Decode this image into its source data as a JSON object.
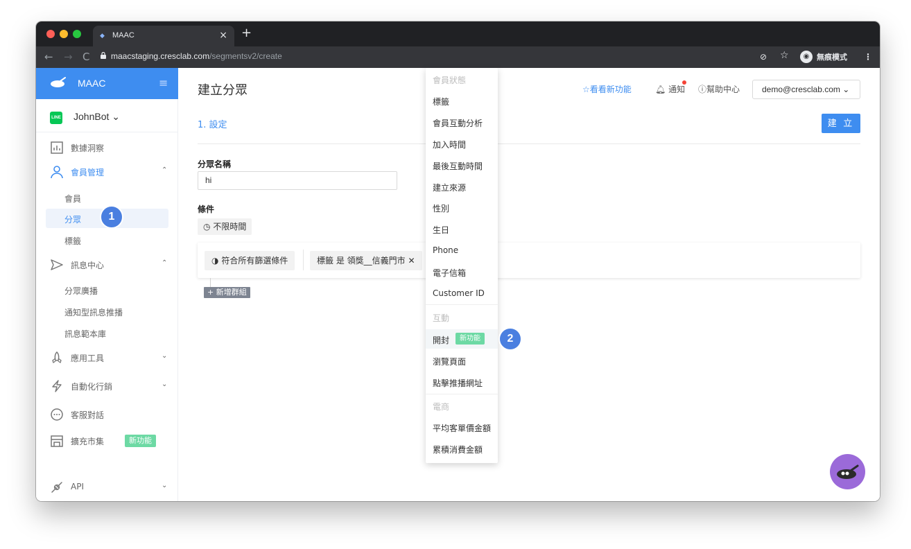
{
  "browser": {
    "tab_title": "MAAC",
    "url_host": "maacstaging.cresclab.com",
    "url_path": "/segmentsv2/create",
    "incognito_label": "無痕模式"
  },
  "sidebar": {
    "brand": "MAAC",
    "bot_name": "JohnBot",
    "line_badge": "LINE",
    "items": [
      {
        "label": "數據洞察"
      },
      {
        "label": "會員管理"
      },
      {
        "label": "會員"
      },
      {
        "label": "分眾"
      },
      {
        "label": "標籤"
      },
      {
        "label": "訊息中心"
      },
      {
        "label": "分眾廣播"
      },
      {
        "label": "通知型訊息推播"
      },
      {
        "label": "訊息範本庫"
      },
      {
        "label": "應用工具"
      },
      {
        "label": "自動化行銷"
      },
      {
        "label": "客服對話"
      },
      {
        "label": "擴充市集"
      },
      {
        "label": "API"
      }
    ],
    "new_tag": "新功能"
  },
  "header": {
    "title": "建立分眾",
    "whats_new": "看看新功能",
    "notify": "通知",
    "help": "幫助中心",
    "user": "demo@cresclab.com"
  },
  "form": {
    "step": "1. 設定",
    "create_button": "建 立",
    "name_label": "分眾名稱",
    "name_value": "hi",
    "condition_label": "條件",
    "time_button": "不限時間",
    "match_button": "符合所有篩選條件",
    "tag_chip": "標籤 是 領獎__信義門市",
    "add_group": "+ 新增群組"
  },
  "dropdown": {
    "group_member": "會員狀態",
    "member_items": [
      "標籤",
      "會員互動分析",
      "加入時間",
      "最後互動時間",
      "建立來源",
      "性別",
      "生日",
      "Phone",
      "電子信箱",
      "Customer ID"
    ],
    "group_interaction": "互動",
    "interaction_items": [
      "開封",
      "瀏覽頁面",
      "點擊推播網址"
    ],
    "interaction_new_tag": "新功能",
    "group_ecommerce": "電商",
    "ecommerce_items": [
      "平均客單價金額",
      "累積消費金額"
    ]
  },
  "markers": [
    "1",
    "2"
  ],
  "colors": {
    "primary": "#3e8df0",
    "new_tag": "#6dd9a4",
    "marker": "#4a7fe0",
    "chatbot": "#9b6ad9"
  }
}
